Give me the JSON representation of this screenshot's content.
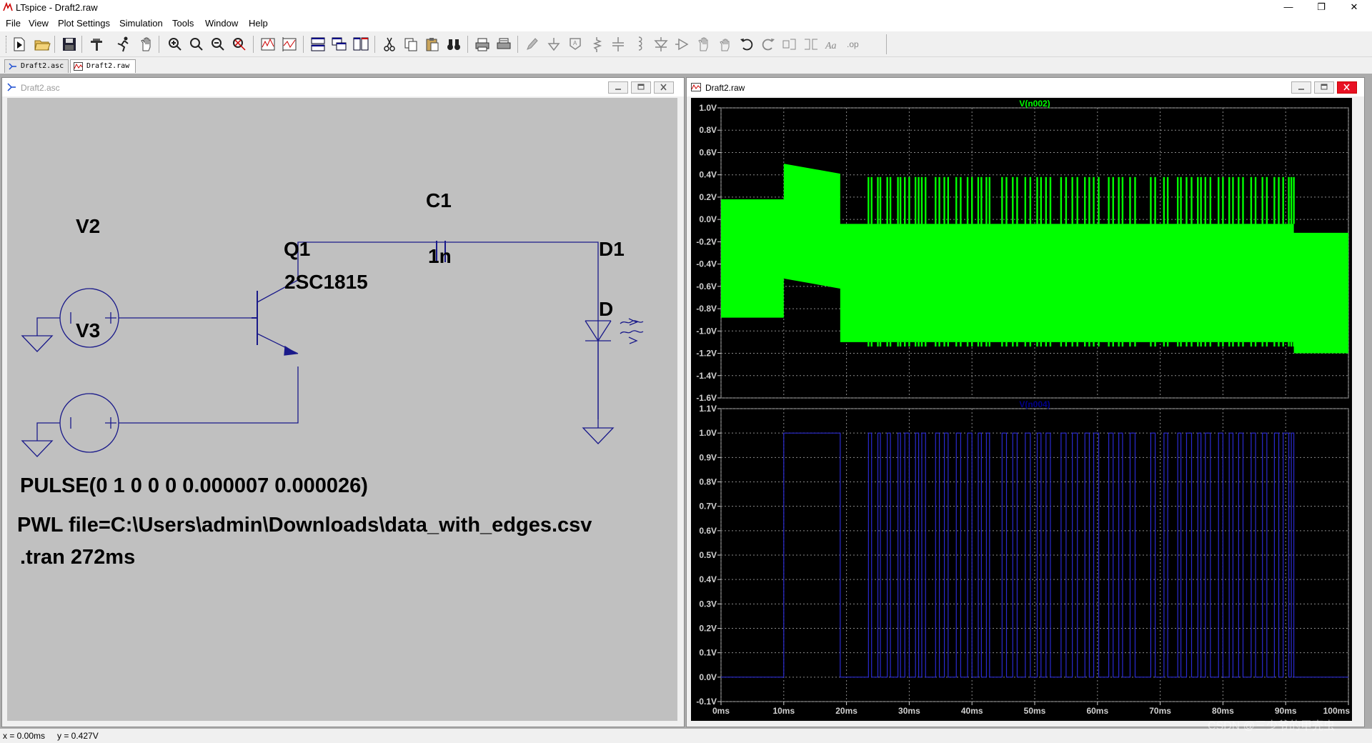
{
  "window": {
    "title": "LTspice - Draft2.raw",
    "controls": [
      "—",
      "❐",
      "✕"
    ]
  },
  "menu": [
    "File",
    "View",
    "Plot Settings",
    "Simulation",
    "Tools",
    "Window",
    "Help"
  ],
  "tabs": [
    {
      "label": "Draft2.asc",
      "icon": "schematic-icon",
      "active": false
    },
    {
      "label": "Draft2.raw",
      "icon": "waveform-icon",
      "active": true
    }
  ],
  "schematic_window": {
    "title": "Draft2.asc",
    "components": {
      "V2": "V2",
      "V3": "V3",
      "Q1": "Q1",
      "Q1_model": "2SC1815",
      "C1": "C1",
      "C1_value": "1n",
      "D1": "D1",
      "D1_model": "D"
    },
    "directives": {
      "pulse": "PULSE(0 1 0 0 0 0.000007 0.000026)",
      "pwl": "PWL file=C:\\Users\\admin\\Downloads\\data_with_edges.csv",
      "tran": ".tran 272ms"
    },
    "wire_color": "#00008b"
  },
  "waveform_window": {
    "title": "Draft2.raw",
    "background": "#000000",
    "grid_color": "#8a8a8a"
  },
  "chart_data": [
    {
      "type": "area",
      "title": "V(n002)",
      "trace_color": "#00ff00",
      "ylim": [
        -1.6,
        1.0
      ],
      "yticks": [
        "1.0V",
        "0.8V",
        "0.6V",
        "0.4V",
        "0.2V",
        "0.0V",
        "-0.2V",
        "-0.4V",
        "-0.6V",
        "-0.8V",
        "-1.0V",
        "-1.2V",
        "-1.4V",
        "-1.6V"
      ],
      "xlim": [
        0,
        100
      ],
      "x_unit": "ms",
      "grid": true,
      "envelope": {
        "x": [
          0,
          10,
          10,
          19,
          19,
          91.3,
          91.3,
          100
        ],
        "upper": [
          0.18,
          0.18,
          0.5,
          0.41,
          -0.04,
          -0.04,
          -0.12,
          -0.12
        ],
        "lower": [
          -0.88,
          -0.88,
          -0.53,
          -0.62,
          -1.1,
          -1.1,
          -1.2,
          -1.2
        ]
      },
      "spikes_high": 0.38,
      "spikes_low": -1.12
    },
    {
      "type": "line",
      "title": "V(n004)",
      "trace_color": "#00008b",
      "ylim": [
        -0.1,
        1.1
      ],
      "yticks": [
        "1.1V",
        "1.0V",
        "0.9V",
        "0.8V",
        "0.7V",
        "0.6V",
        "0.5V",
        "0.4V",
        "0.3V",
        "0.2V",
        "0.1V",
        "0.0V",
        "-0.1V"
      ],
      "xlim": [
        0,
        100
      ],
      "x_unit": "ms",
      "xticks": [
        "0ms",
        "10ms",
        "20ms",
        "30ms",
        "40ms",
        "50ms",
        "60ms",
        "70ms",
        "80ms",
        "90ms",
        "100ms"
      ],
      "grid": true,
      "high_intervals": [
        [
          10,
          19
        ],
        [
          23.5,
          24
        ],
        [
          25,
          25.4
        ],
        [
          26.5,
          27
        ],
        [
          28.2,
          28.6
        ],
        [
          29.3,
          30
        ],
        [
          31,
          31.5
        ],
        [
          32,
          32.6
        ],
        [
          34.2,
          34.8
        ],
        [
          35.6,
          36.2
        ],
        [
          37.5,
          38.2
        ],
        [
          39.3,
          40
        ],
        [
          41,
          41.5
        ],
        [
          42.3,
          42.8
        ],
        [
          44.8,
          45.5
        ],
        [
          46.5,
          47.2
        ],
        [
          48.5,
          49.3
        ],
        [
          50.4,
          51
        ],
        [
          51.8,
          52.5
        ],
        [
          54.2,
          55
        ],
        [
          56,
          56.8
        ],
        [
          58,
          58.7
        ],
        [
          59.4,
          60.2
        ],
        [
          61.8,
          62.5
        ],
        [
          63.4,
          64
        ],
        [
          65.2,
          66
        ],
        [
          68.5,
          69.2
        ],
        [
          70.6,
          71.2
        ],
        [
          72.8,
          73.3
        ],
        [
          74.2,
          75
        ],
        [
          76,
          76.5
        ],
        [
          77.2,
          78
        ],
        [
          79.3,
          80
        ],
        [
          81,
          81.6
        ],
        [
          82.5,
          83.2
        ],
        [
          84.5,
          85.2
        ],
        [
          86.3,
          87
        ],
        [
          88.2,
          88.9
        ],
        [
          89.6,
          90.5
        ],
        [
          90.9,
          91.3
        ]
      ]
    }
  ],
  "status": {
    "x": "x = 0.00ms",
    "y": "y = 0.427V"
  },
  "watermark": "CSDN @三少爷的甲壳虫"
}
